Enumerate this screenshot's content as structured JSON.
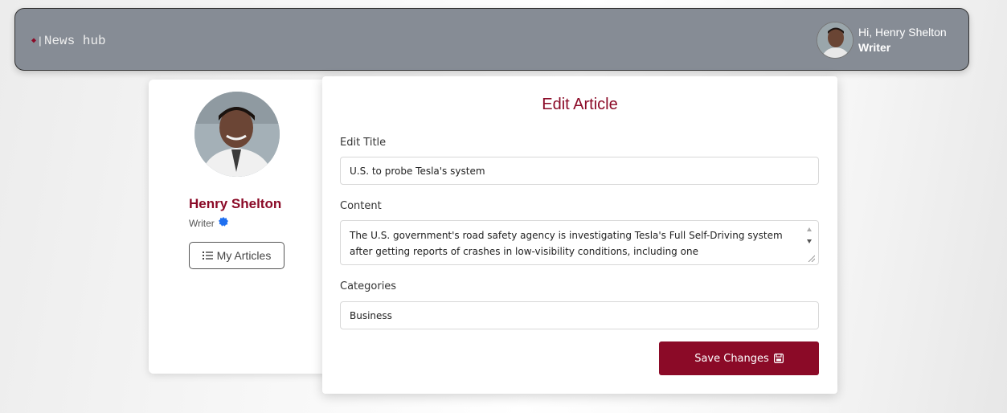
{
  "navbar": {
    "brand": "News hub",
    "user_greeting": "Hi, Henry Shelton",
    "user_role": "Writer"
  },
  "profile": {
    "name": "Henry Shelton",
    "role": "Writer",
    "my_articles_label": "My Articles"
  },
  "edit_form": {
    "heading": "Edit Article",
    "title_label": "Edit Title",
    "title_value": "U.S. to probe Tesla's system",
    "content_label": "Content",
    "content_value": "The U.S. government's road safety agency is investigating Tesla's Full Self-Driving system after getting reports of crashes in low-visibility conditions, including one",
    "categories_label": "Categories",
    "categories_value": "Business",
    "save_label": "Save Changes"
  },
  "colors": {
    "accent": "#8b0a27",
    "navbar_bg": "#868c95",
    "verified": "#1e6ff0"
  }
}
